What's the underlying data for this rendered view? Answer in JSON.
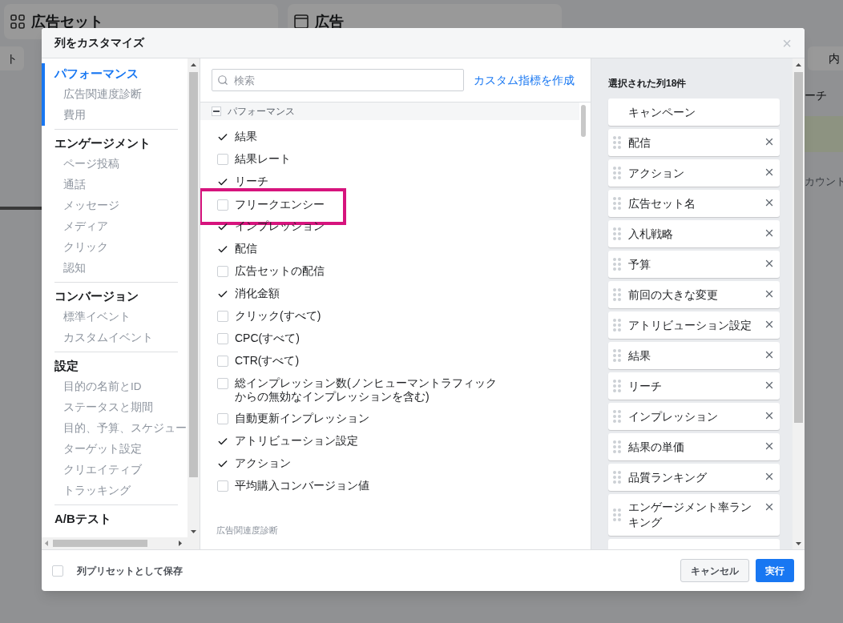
{
  "background": {
    "panels": [
      {
        "title": "広告セット",
        "kind": "grid"
      },
      {
        "title": "広告",
        "kind": "window"
      }
    ],
    "left_button": "ト",
    "right_button": "内",
    "column_header": "ーチ",
    "cell": "カウント"
  },
  "dialog": {
    "title": "列をカスタマイズ",
    "close": "×"
  },
  "nav": {
    "sections": [
      {
        "label": "パフォーマンス",
        "selected": true,
        "children": [
          {
            "label": "広告関連度診断"
          },
          {
            "label": "費用"
          }
        ]
      },
      {
        "label": "エンゲージメント",
        "selected": false,
        "children": [
          {
            "label": "ページ投稿"
          },
          {
            "label": "通話"
          },
          {
            "label": "メッセージ"
          },
          {
            "label": "メディア"
          },
          {
            "label": "クリック"
          },
          {
            "label": "認知"
          }
        ]
      },
      {
        "label": "コンバージョン",
        "selected": false,
        "children": [
          {
            "label": "標準イベント"
          },
          {
            "label": "カスタムイベント"
          }
        ]
      },
      {
        "label": "設定",
        "selected": false,
        "children": [
          {
            "label": "目的の名前とID"
          },
          {
            "label": "ステータスと期間"
          },
          {
            "label": "目的、予算、スケジュー"
          },
          {
            "label": "ターゲット設定"
          },
          {
            "label": "クリエイティブ"
          },
          {
            "label": "トラッキング"
          }
        ]
      },
      {
        "label": "A/Bテスト",
        "selected": false
      }
    ]
  },
  "search": {
    "placeholder": "検索"
  },
  "create_link": "カスタム指標を作成",
  "metrics": {
    "group": "パフォーマンス",
    "expanded": true,
    "items": [
      {
        "label": "結果",
        "checked": true,
        "highlighted": false
      },
      {
        "label": "結果レート",
        "checked": false,
        "highlighted": false
      },
      {
        "label": "リーチ",
        "checked": true,
        "highlighted": false
      },
      {
        "label": "フリークエンシー",
        "checked": false,
        "highlighted": true
      },
      {
        "label": "インプレッション",
        "checked": true,
        "highlighted": false
      },
      {
        "label": "配信",
        "checked": true,
        "highlighted": false
      },
      {
        "label": "広告セットの配信",
        "checked": false,
        "highlighted": false
      },
      {
        "label": "消化金額",
        "checked": true,
        "highlighted": false
      },
      {
        "label": "クリック(すべて)",
        "checked": false,
        "highlighted": false
      },
      {
        "label": "CPC(すべて)",
        "checked": false,
        "highlighted": false
      },
      {
        "label": "CTR(すべて)",
        "checked": false,
        "highlighted": false
      },
      {
        "label": "総インプレッション数(ノンヒューマントラフィックからの無効なインプレッションを含む)",
        "checked": false,
        "highlighted": false
      },
      {
        "label": "自動更新インプレッション",
        "checked": false,
        "highlighted": false
      },
      {
        "label": "アトリビューション設定",
        "checked": true,
        "highlighted": false
      },
      {
        "label": "アクション",
        "checked": true,
        "highlighted": false
      },
      {
        "label": "平均購入コンバージョン値",
        "checked": false,
        "highlighted": false
      }
    ],
    "next_group": "広告関連度診断"
  },
  "selected_columns": {
    "title": "選択された列18件",
    "items": [
      {
        "label": "キャンペーン",
        "removable": false
      },
      {
        "label": "配信",
        "removable": true
      },
      {
        "label": "アクション",
        "removable": true
      },
      {
        "label": "広告セット名",
        "removable": true
      },
      {
        "label": "入札戦略",
        "removable": true
      },
      {
        "label": "予算",
        "removable": true
      },
      {
        "label": "前回の大きな変更",
        "removable": true
      },
      {
        "label": "アトリビューション設定",
        "removable": true
      },
      {
        "label": "結果",
        "removable": true
      },
      {
        "label": "リーチ",
        "removable": true
      },
      {
        "label": "インプレッション",
        "removable": true
      },
      {
        "label": "結果の単価",
        "removable": true
      },
      {
        "label": "品質ランキング",
        "removable": true
      },
      {
        "label": "エンゲージメント率ランキング",
        "removable": true
      }
    ]
  },
  "footer": {
    "save_preset": {
      "label": "列プリセットとして保存",
      "checked": false
    },
    "cancel": "キャンセル",
    "apply": "実行"
  }
}
